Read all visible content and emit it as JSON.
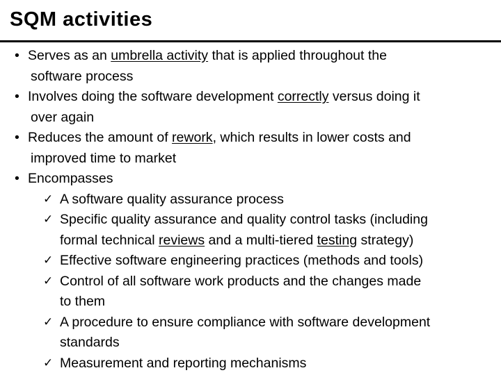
{
  "slide": {
    "title": "SQM activities",
    "bullets": [
      {
        "marker": "•",
        "lines": [
          [
            "Serves as an ",
            {
              "u": "umbrella activity"
            },
            " that is applied throughout the"
          ],
          [
            "software process"
          ]
        ]
      },
      {
        "marker": "•",
        "lines": [
          [
            "Involves doing the software development ",
            {
              "u": "correctly"
            },
            " versus doing it"
          ],
          [
            "over again"
          ]
        ]
      },
      {
        "marker": "•",
        "lines": [
          [
            "Reduces the amount of ",
            {
              "u": "rework"
            },
            ", which results in lower costs and"
          ],
          [
            "improved time to market"
          ]
        ]
      },
      {
        "marker": "•",
        "lines": [
          [
            "Encompasses"
          ]
        ],
        "subitems": [
          {
            "marker": "✓",
            "lines": [
              [
                "A software quality assurance process"
              ]
            ]
          },
          {
            "marker": "✓",
            "lines": [
              [
                "Specific quality assurance and quality control tasks (including"
              ],
              [
                "formal technical ",
                {
                  "u": "reviews"
                },
                " and a multi-tiered ",
                {
                  "u": "testing"
                },
                " strategy)"
              ]
            ]
          },
          {
            "marker": "✓",
            "lines": [
              [
                "Effective software engineering practices (methods and tools)"
              ]
            ]
          },
          {
            "marker": "✓",
            "lines": [
              [
                "Control of all software work products and the changes made"
              ],
              [
                "to them"
              ]
            ]
          },
          {
            "marker": "✓",
            "lines": [
              [
                "A procedure to ensure compliance with software development"
              ],
              [
                "standards"
              ]
            ]
          },
          {
            "marker": "✓",
            "lines": [
              [
                "Measurement and reporting mechanisms"
              ]
            ]
          }
        ]
      }
    ]
  }
}
